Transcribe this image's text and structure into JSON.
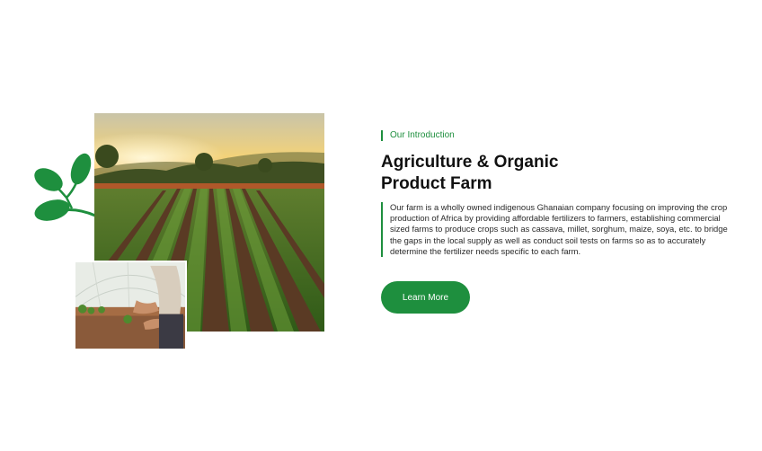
{
  "intro": {
    "eyebrow": "Our Introduction",
    "title_line1": "Agriculture & Organic",
    "title_line2": "Product Farm",
    "description": "Our farm is a wholly owned indigenous Ghanaian company focusing on improving the crop production of Africa by providing affordable fertilizers to farmers, establishing commercial sized farms to produce crops such as cassava, millet, sorghum, maize, soya, etc. to bridge the gaps in the local supply as well as conduct soil tests on farms so as to accurately determine the fertilizer needs specific to each farm.",
    "button_label": "Learn More"
  },
  "colors": {
    "accent": "#1e8f3e",
    "title": "#111111",
    "text": "#2a2a2a",
    "background": "#ffffff"
  },
  "icons": {
    "decoration": "leaf-branch-icon"
  }
}
